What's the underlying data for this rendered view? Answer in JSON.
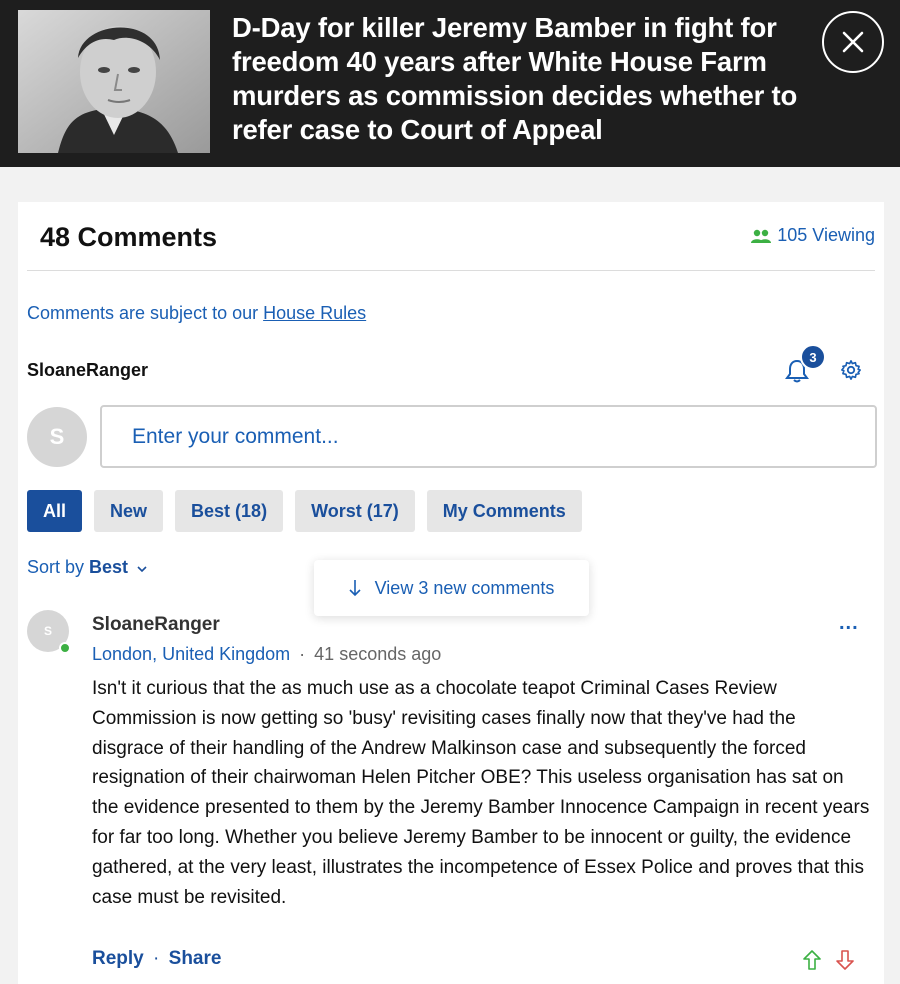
{
  "article": {
    "headline": "D-Day for killer Jeremy Bamber in fight for freedom 40 years after White House Farm murders as commission decides whether to refer case to Court of Appeal"
  },
  "comments_panel": {
    "count_label": "48 Comments",
    "viewing_label": "105 Viewing",
    "rules_prefix": "Comments are subject to our ",
    "rules_link": "House Rules",
    "current_user": "SloaneRanger",
    "notification_count": "3",
    "avatar_initial": "S",
    "input_placeholder": "Enter your comment...",
    "tabs": [
      {
        "label": "All",
        "active": true
      },
      {
        "label": "New",
        "active": false
      },
      {
        "label": "Best (18)",
        "active": false
      },
      {
        "label": "Worst (17)",
        "active": false
      },
      {
        "label": "My Comments",
        "active": false
      }
    ],
    "sort_prefix": "Sort by ",
    "sort_value": "Best",
    "new_comments_label": "View 3 new comments"
  },
  "comment": {
    "author": "SloaneRanger",
    "avatar_initial": "S",
    "location": "London, United Kingdom",
    "separator": "·",
    "time": "41 seconds ago",
    "more": "...",
    "body": "Isn't it curious that the as much use as a chocolate teapot Criminal Cases Review Commission is now getting so 'busy' revisiting cases finally now that they've had the disgrace of their handling of the Andrew Malkinson case and subsequently the forced resignation of their chairwoman Helen Pitcher OBE? This useless organisation has sat on the evidence presented to them by the Jeremy Bamber Innocence Campaign in recent years for far too long. Whether you believe Jeremy Bamber to be innocent or guilty, the evidence gathered, at the very least, illustrates the incompetence of Essex Police and proves that this case must be revisited.",
    "reply_label": "Reply",
    "action_separator": "·",
    "share_label": "Share"
  },
  "colors": {
    "accent_blue": "#1a4f9c",
    "link_blue": "#1a5fb4",
    "online_green": "#3cb043",
    "upvote_green": "#3cb043",
    "downvote_red": "#d9534f",
    "header_bg": "#1e1e1e"
  }
}
